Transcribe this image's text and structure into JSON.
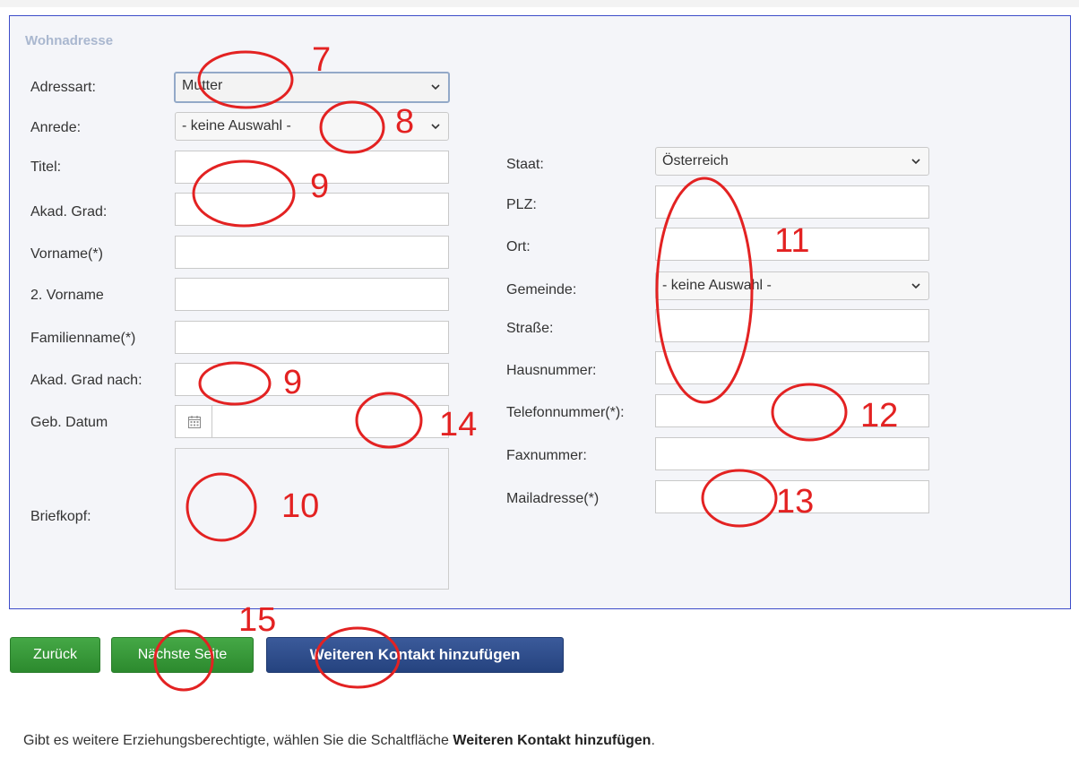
{
  "section": {
    "legend": "Wohnadresse"
  },
  "left_fields": {
    "adressart": {
      "label": "Adressart:",
      "value": "Mutter"
    },
    "anrede": {
      "label": "Anrede:",
      "value": "- keine Auswahl -"
    },
    "titel": {
      "label": "Titel:"
    },
    "akad_grad": {
      "label": "Akad. Grad:"
    },
    "vorname": {
      "label": "Vorname(*)"
    },
    "zweiter_vorname": {
      "label": "2. Vorname"
    },
    "familienname": {
      "label": "Familienname(*)"
    },
    "akad_grad_nach": {
      "label": "Akad. Grad nach:"
    },
    "geb_datum": {
      "label": "Geb. Datum"
    },
    "briefkopf": {
      "label": "Briefkopf:"
    }
  },
  "right_fields": {
    "staat": {
      "label": "Staat:",
      "value": "Österreich"
    },
    "plz": {
      "label": "PLZ:"
    },
    "ort": {
      "label": "Ort:"
    },
    "gemeinde": {
      "label": "Gemeinde:",
      "value": "- keine Auswahl -"
    },
    "strasse": {
      "label": "Straße:"
    },
    "hausnummer": {
      "label": "Hausnummer:"
    },
    "telefonnummer": {
      "label": "Telefonnummer(*):"
    },
    "faxnummer": {
      "label": "Faxnummer:"
    },
    "mailadresse": {
      "label": "Mailadresse(*)"
    }
  },
  "buttons": {
    "zurueck": "Zurück",
    "naechste_seite": "Nächste Seite",
    "weiteren_kontakt": "Weiteren Kontakt hinzufügen"
  },
  "footer": {
    "text_before": "Gibt es weitere Erziehungsberechtigte, wählen Sie die Schaltfläche ",
    "text_bold": "Weiteren Kontakt hinzufügen",
    "text_after": "."
  },
  "annotations": {
    "n7": "7",
    "n8": "8",
    "n9a": "9",
    "n9b": "9",
    "n10": "10",
    "n11": "11",
    "n12": "12",
    "n13": "13",
    "n14": "14",
    "n15": "15",
    "color": "#e32222"
  },
  "colors": {
    "fieldset_border": "#3c4cc9",
    "legend": "#a9b7cf",
    "green_button": "#2c8a2e",
    "blue_button": "#25437f"
  },
  "icons": {
    "calendar": "calendar-icon",
    "chevron": "chevron-down-icon"
  }
}
